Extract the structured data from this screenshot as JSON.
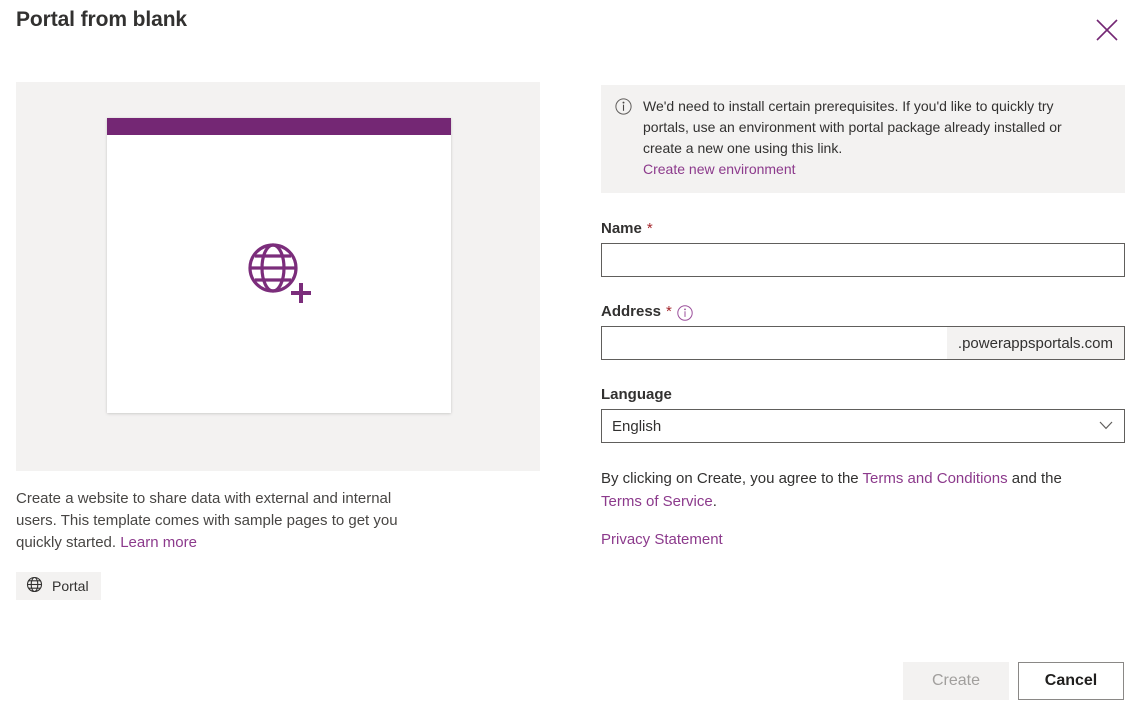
{
  "header": {
    "title": "Portal from blank",
    "close_label": "Close"
  },
  "left_panel": {
    "preview": {
      "bar_color": "#742774",
      "icon": "globe-plus-icon",
      "icon_color": "#7b2d7b"
    },
    "description_part1": "Create a website to share data with external and internal users. This template comes with sample pages to get you quickly started. ",
    "learn_more_label": "Learn more",
    "tag": {
      "icon": "globe-icon",
      "label": "Portal"
    }
  },
  "info_box": {
    "icon": "info-circle-icon",
    "message": "We'd need to install certain prerequisites. If you'd like to quickly try portals, use an environment with portal package already installed or create a new one using this link.",
    "link_label": "Create new environment"
  },
  "form": {
    "name": {
      "label": "Name",
      "required_marker": "*",
      "value": "",
      "placeholder": ""
    },
    "address": {
      "label": "Address",
      "required_marker": "*",
      "info_icon": "info-circle-icon",
      "value": "",
      "placeholder": "",
      "suffix": ".powerappsportals.com"
    },
    "language": {
      "label": "Language",
      "selected": "English",
      "chevron": "chevron-down-icon",
      "options": [
        "English"
      ]
    }
  },
  "legal": {
    "terms_prefix": "By clicking on Create, you agree to the ",
    "terms_and_conditions": "Terms and Conditions",
    "terms_middle": " and the ",
    "terms_of_service": "Terms of Service",
    "terms_suffix": ".",
    "privacy_statement": "Privacy Statement"
  },
  "footer": {
    "create_label": "Create",
    "cancel_label": "Cancel"
  },
  "colors": {
    "accent_purple": "#742774",
    "link_purple": "#8c3a8c",
    "required_red": "#a4262c",
    "panel_gray": "#f3f2f1",
    "border_gray": "#605e5c"
  }
}
